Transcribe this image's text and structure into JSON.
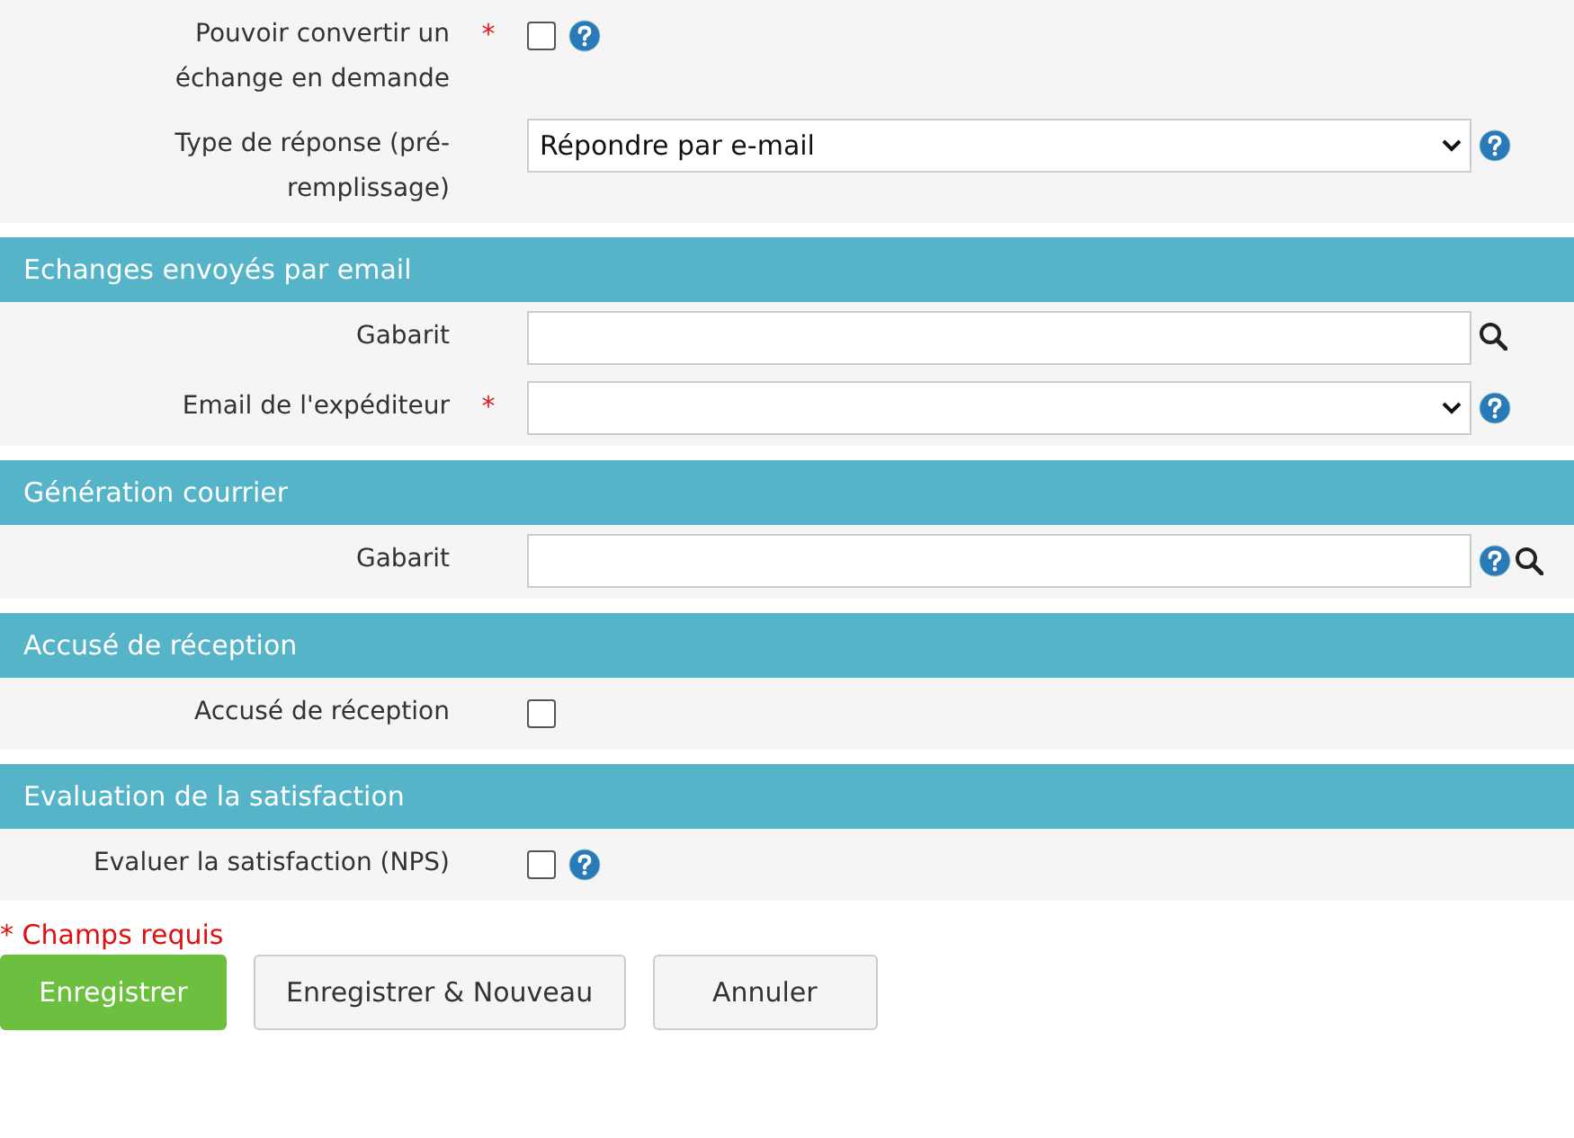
{
  "sections": [
    {
      "fields": [
        {
          "kind": "checkbox",
          "label": "Pouvoir convertir un échange en demande",
          "required_mark": "*",
          "checked": false,
          "help": true
        },
        {
          "kind": "select",
          "label": "Type de réponse (pré-remplissage)",
          "value": "Répondre par e-mail",
          "help": true
        }
      ]
    },
    {
      "title": "Echanges envoyés par email",
      "fields": [
        {
          "kind": "lookup",
          "label": "Gabarit",
          "search": true
        },
        {
          "kind": "select",
          "label": "Email de l'expéditeur",
          "required_mark": "*",
          "help": true
        }
      ]
    },
    {
      "title": "Génération courrier",
      "fields": [
        {
          "kind": "lookup",
          "label": "Gabarit",
          "help": true,
          "search": true
        }
      ]
    },
    {
      "title": "Accusé de réception",
      "fields": [
        {
          "kind": "checkbox",
          "label": "Accusé de réception",
          "checked": false
        }
      ]
    },
    {
      "title": "Evaluation de la satisfaction",
      "fields": [
        {
          "kind": "checkbox",
          "label": "Evaluer la satisfaction (NPS)",
          "checked": false,
          "help": true
        }
      ]
    }
  ],
  "required_note": "* Champs requis",
  "buttons": [
    {
      "kind": "primary",
      "label": "Enregistrer"
    },
    {
      "kind": "default",
      "label": "Enregistrer & Nouveau"
    },
    {
      "kind": "default",
      "label": "Annuler"
    }
  ]
}
